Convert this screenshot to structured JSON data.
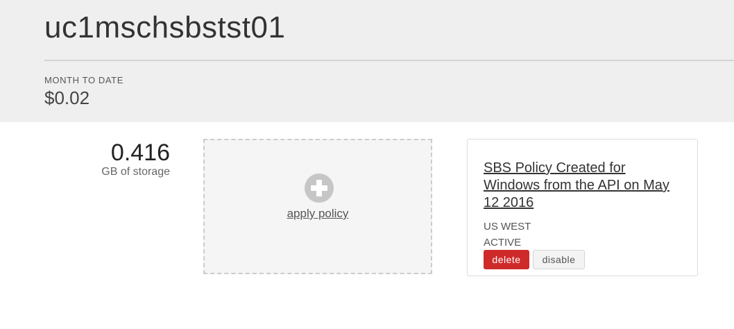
{
  "server": {
    "name": "uc1mschsbstst01"
  },
  "billing": {
    "label": "MONTH TO DATE",
    "value": "$0.02"
  },
  "storage": {
    "value": "0.416",
    "label": "GB of storage"
  },
  "apply_policy": {
    "icon": "plus-circle-icon",
    "label": "apply policy"
  },
  "policy": {
    "title": "SBS Policy Created for Windows from the API on May 12 2016",
    "region": "US WEST",
    "status": "ACTIVE",
    "delete_label": "delete",
    "disable_label": "disable"
  },
  "colors": {
    "header_bg": "#efefef",
    "delete_button": "#cf2a2a",
    "text": "#333333"
  }
}
